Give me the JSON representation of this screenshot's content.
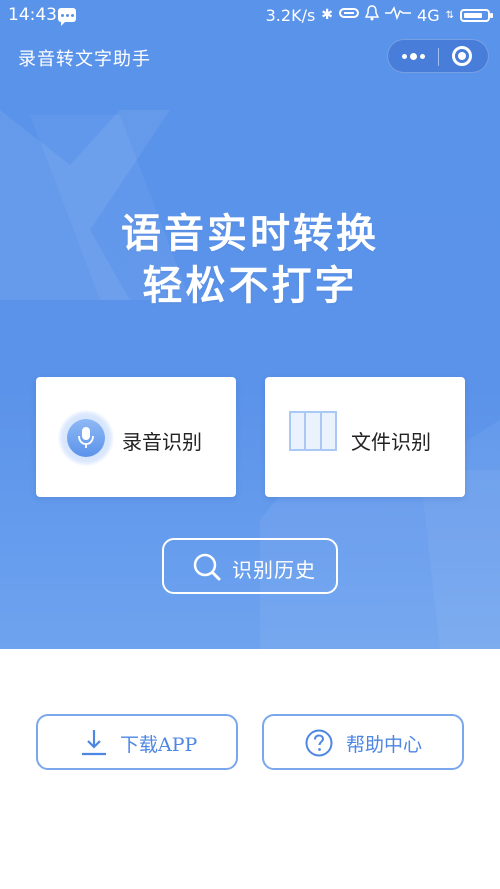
{
  "status_bar": {
    "time": "14:43",
    "network_speed": "3.2K/s",
    "network_type": "4G"
  },
  "app": {
    "title": "录音转文字助手"
  },
  "headline": {
    "line1": "语音实时转换",
    "line2": "轻松不打字"
  },
  "cards": {
    "record_label": "录音识别",
    "file_label": "文件识别"
  },
  "history_button": {
    "label": "识别历史"
  },
  "bottom": {
    "download_label": "下载APP",
    "help_label": "帮助中心"
  },
  "colors": {
    "primary": "#5b93ea",
    "button_border": "#7ba7ec",
    "button_text": "#4d86e3"
  }
}
